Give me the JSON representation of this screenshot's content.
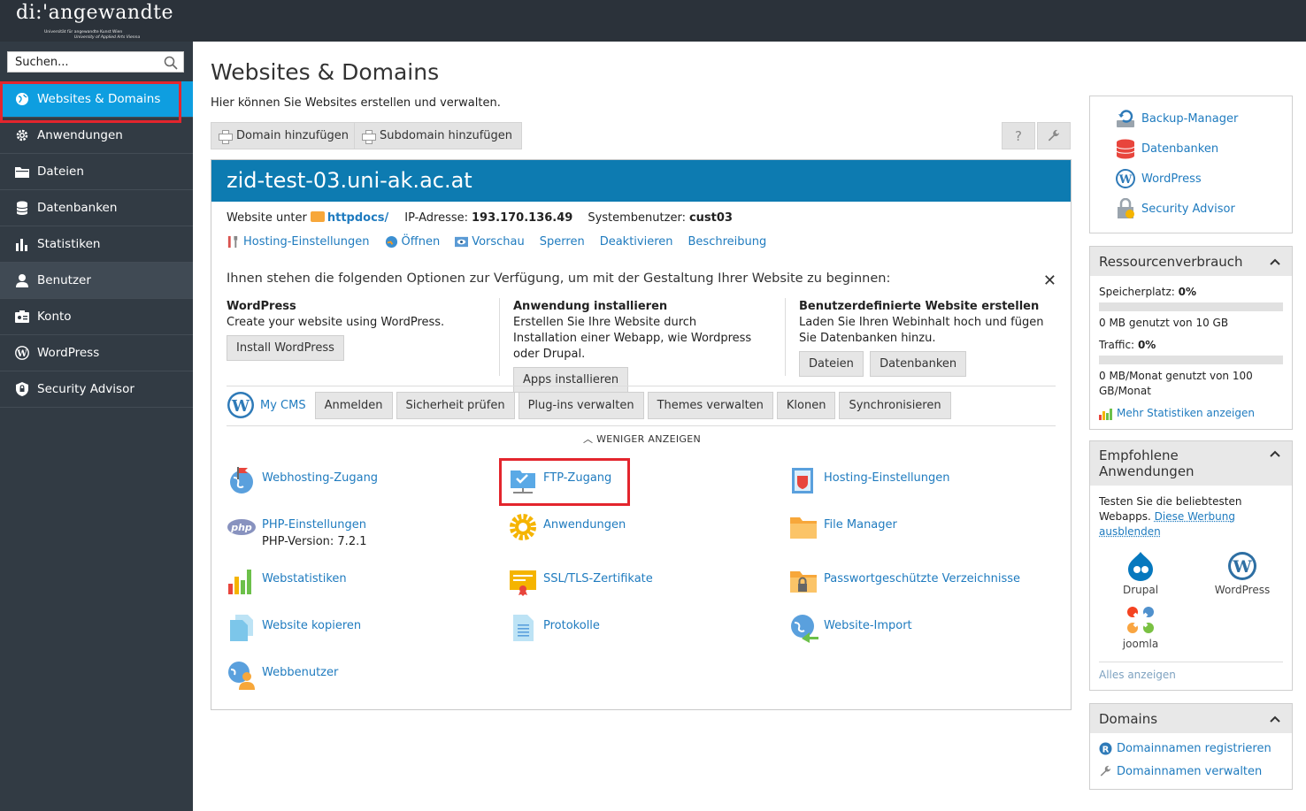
{
  "header": {
    "logo_text": "di:'angewandte",
    "logo_sub1": "Universität für angewandte Kunst Wien",
    "logo_sub2": "University of Applied Arts Vienna"
  },
  "sidebar": {
    "search_placeholder": "Suchen...",
    "items": [
      {
        "label": "Websites & Domains",
        "icon": "globe-icon"
      },
      {
        "label": "Anwendungen",
        "icon": "gear-icon"
      },
      {
        "label": "Dateien",
        "icon": "folder-icon"
      },
      {
        "label": "Datenbanken",
        "icon": "database-icon"
      },
      {
        "label": "Statistiken",
        "icon": "bar-chart-icon"
      },
      {
        "label": "Benutzer",
        "icon": "user-icon"
      },
      {
        "label": "Konto",
        "icon": "id-card-icon"
      },
      {
        "label": "WordPress",
        "icon": "wordpress-icon"
      },
      {
        "label": "Security Advisor",
        "icon": "shield-icon"
      }
    ]
  },
  "main": {
    "title": "Websites & Domains",
    "description": "Hier können Sie Websites erstellen und verwalten.",
    "add_domain": "Domain hinzufügen",
    "add_subdomain": "Subdomain hinzufügen",
    "help_glyph": "?"
  },
  "domain": {
    "name": "zid-test-03.uni-ak.ac.at",
    "website_under_label": "Website unter",
    "docroot": "httpdocs/",
    "ip_label": "IP-Adresse:",
    "ip": "193.170.136.49",
    "sysuser_label": "Systembenutzer:",
    "sysuser": "cust03",
    "actions": [
      "Hosting-Einstellungen",
      "Öffnen",
      "Vorschau",
      "Sperren",
      "Deaktivieren",
      "Beschreibung"
    ],
    "intro": "Ihnen stehen die folgenden Optionen zur Verfügung, um mit der Gestaltung Ihrer Website zu beginnen:",
    "options": [
      {
        "title": "WordPress",
        "text": "Create your website using WordPress.",
        "buttons": [
          "Install WordPress"
        ]
      },
      {
        "title": "Anwendung installieren",
        "text": "Erstellen Sie Ihre Website durch Installation einer Webapp, wie Wordpress oder Drupal.",
        "buttons": [
          "Apps installieren"
        ]
      },
      {
        "title": "Benutzerdefinierte Website erstellen",
        "text": "Laden Sie Ihren Webinhalt hoch und fügen Sie Datenbanken hinzu.",
        "buttons": [
          "Dateien",
          "Datenbanken"
        ]
      }
    ],
    "cms_name": "My CMS",
    "cms_buttons": [
      "Anmelden",
      "Sicherheit prüfen",
      "Plug-ins verwalten",
      "Themes verwalten",
      "Klonen",
      "Synchronisieren"
    ],
    "show_less": "WENIGER ANZEIGEN",
    "tools": [
      {
        "label": "Webhosting-Zugang",
        "icon": "webhosting-access-icon"
      },
      {
        "label": "FTP-Zugang",
        "icon": "ftp-icon"
      },
      {
        "label": "Hosting-Einstellungen",
        "icon": "hosting-settings-icon"
      },
      {
        "label": "PHP-Einstellungen",
        "icon": "php-icon",
        "sub": "PHP-Version: 7.2.1"
      },
      {
        "label": "Anwendungen",
        "icon": "applications-gear-icon"
      },
      {
        "label": "File Manager",
        "icon": "file-manager-icon"
      },
      {
        "label": "Webstatistiken",
        "icon": "web-statistics-icon"
      },
      {
        "label": "SSL/TLS-Zertifikate",
        "icon": "certificate-icon"
      },
      {
        "label": "Passwortgeschützte Verzeichnisse",
        "icon": "protected-folder-icon"
      },
      {
        "label": "Website kopieren",
        "icon": "copy-website-icon"
      },
      {
        "label": "Protokolle",
        "icon": "logs-icon"
      },
      {
        "label": "Website-Import",
        "icon": "website-import-icon"
      },
      {
        "label": "Webbenutzer",
        "icon": "web-users-icon"
      }
    ]
  },
  "right": {
    "quick_links": [
      {
        "label": "Backup-Manager",
        "icon": "backup-icon"
      },
      {
        "label": "Datenbanken",
        "icon": "database-icon"
      },
      {
        "label": "WordPress",
        "icon": "wordpress-icon"
      },
      {
        "label": "Security Advisor",
        "icon": "security-advisor-icon"
      }
    ],
    "resources": {
      "title": "Ressourcenverbrauch",
      "disk_label": "Speicherplatz:",
      "disk_pct": "0%",
      "disk_text": "0 MB genutzt von 10 GB",
      "traffic_label": "Traffic:",
      "traffic_pct": "0%",
      "traffic_text1": "0 MB/Monat genutzt von 100",
      "traffic_text2": "GB/Monat",
      "more_stats": "Mehr Statistiken anzeigen"
    },
    "apps": {
      "title1": "Empfohlene",
      "title2": "Anwendungen",
      "text1": "Testen Sie die beliebtesten",
      "text2": "Webapps.",
      "hide_ad1": "Diese Werbung",
      "hide_ad2": "ausblenden",
      "items": [
        "Drupal",
        "WordPress",
        "joomla"
      ],
      "show_all": "Alles anzeigen"
    },
    "domains": {
      "title": "Domains",
      "links": [
        "Domainnamen registrieren",
        "Domainnamen verwalten"
      ]
    }
  },
  "colors": {
    "accent": "#0e9ee0",
    "header": "#0d7bb1",
    "sidebar": "#323b44",
    "highlight": "#e3252d",
    "link": "#1f7bbf"
  }
}
